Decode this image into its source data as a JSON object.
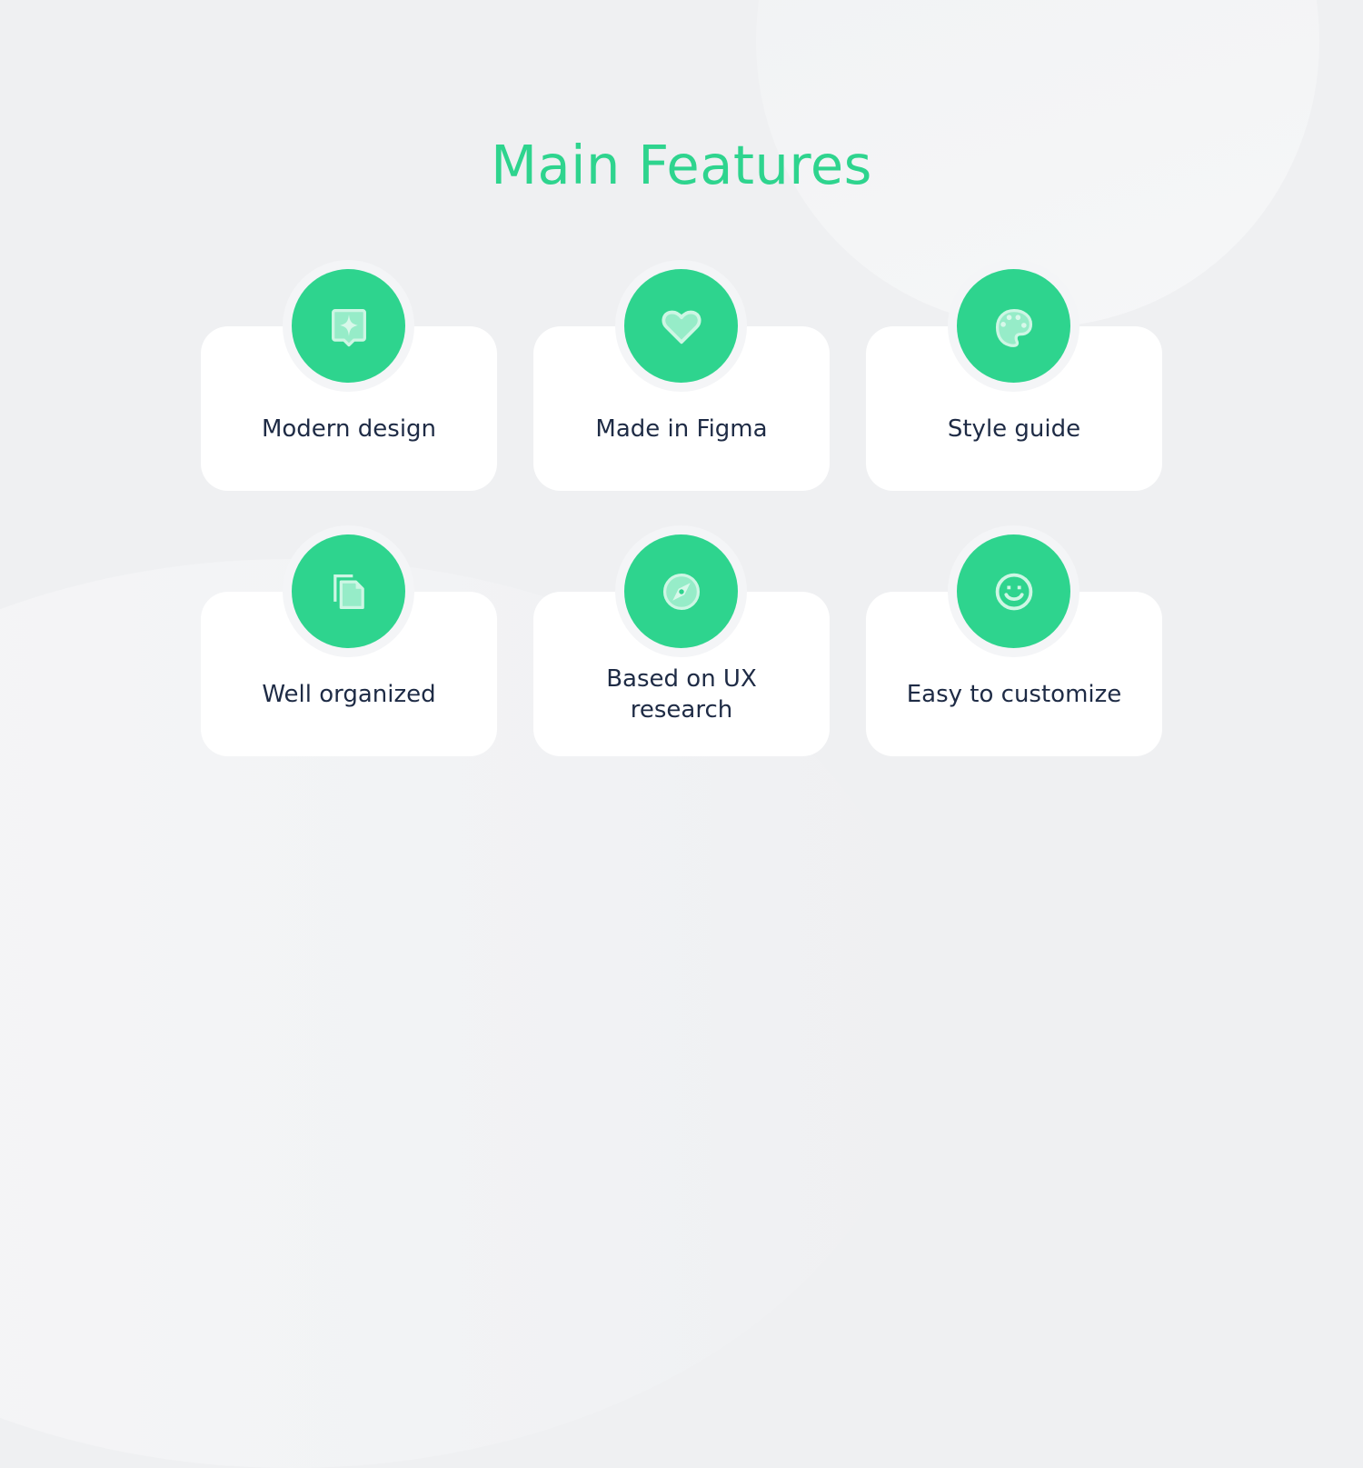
{
  "title": "Main Features",
  "colors": {
    "accent": "#2ED48E",
    "text": "#1E2B45",
    "card": "#FFFFFF",
    "background": "#EFF0F2"
  },
  "features": [
    {
      "label": "Modern design",
      "icon": "sparkle-badge-icon"
    },
    {
      "label": "Made in Figma",
      "icon": "heart-icon"
    },
    {
      "label": "Style guide",
      "icon": "palette-icon"
    },
    {
      "label": "Well organized",
      "icon": "documents-icon"
    },
    {
      "label": "Based  on UX research",
      "line1": "Based  on UX",
      "line2": "research",
      "icon": "compass-icon"
    },
    {
      "label": "Easy to customize",
      "icon": "smiley-icon"
    }
  ]
}
